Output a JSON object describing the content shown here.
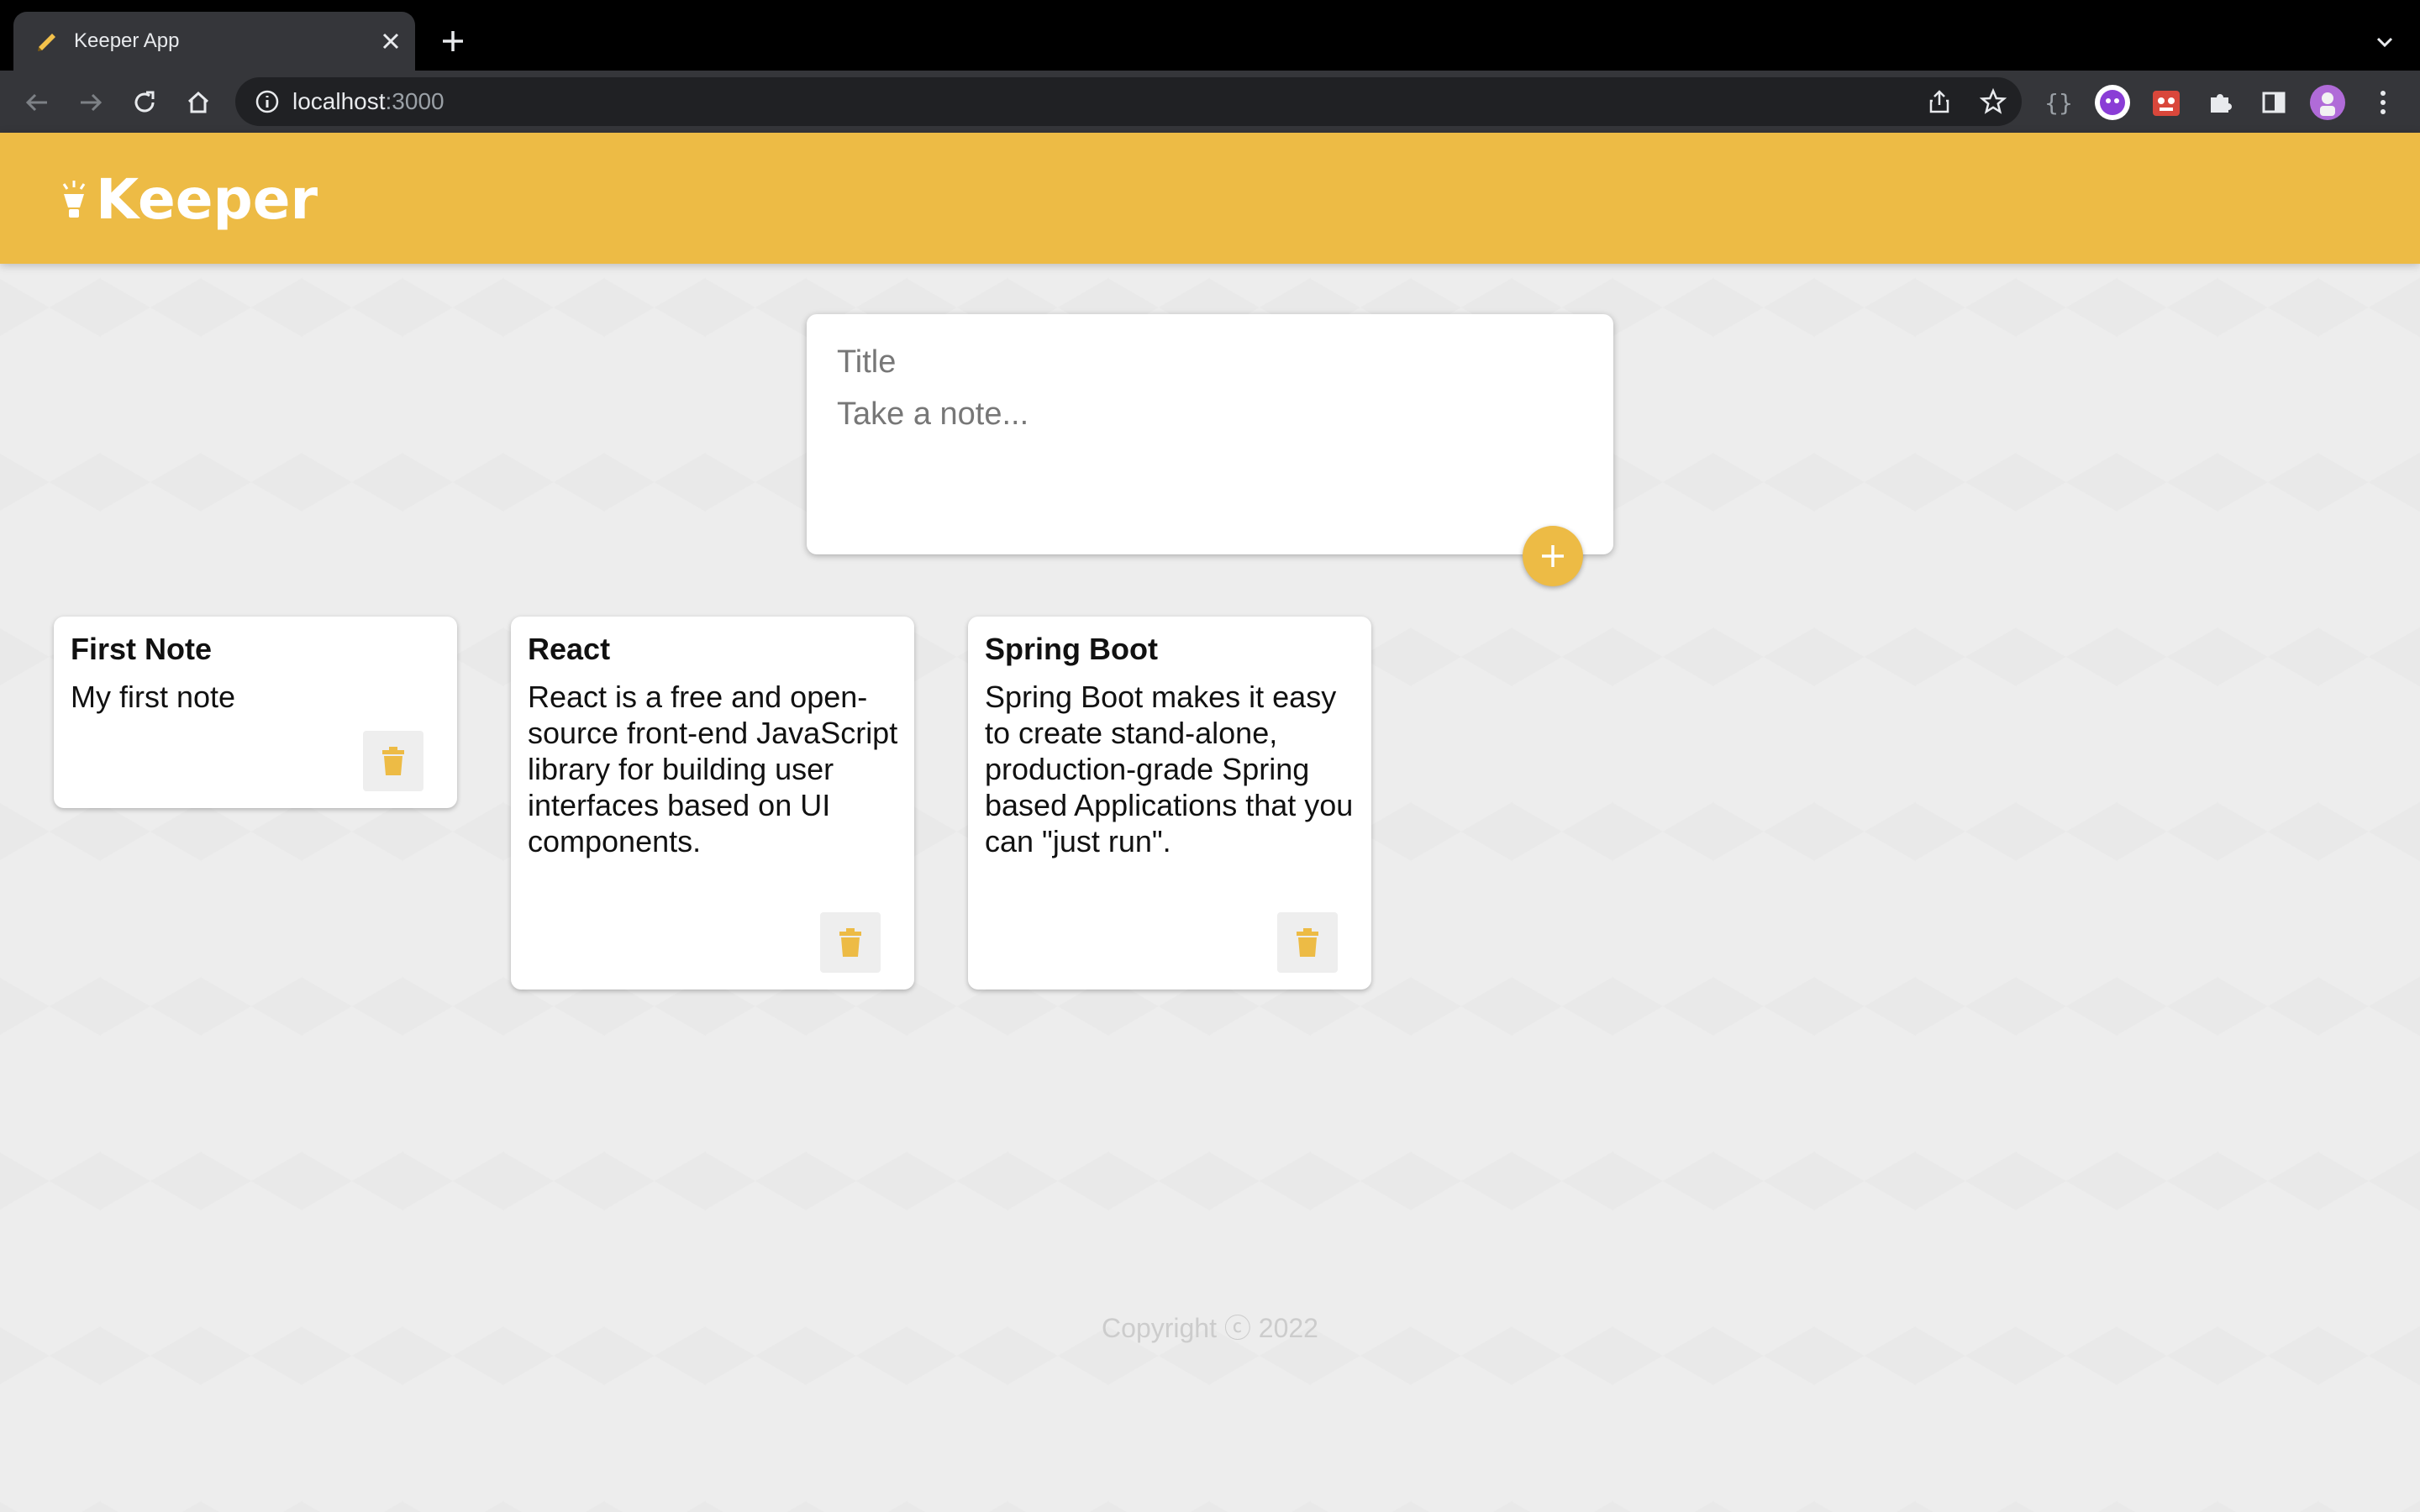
{
  "browser": {
    "tab_title": "Keeper App",
    "url_host": "localhost",
    "url_port": ":3000",
    "icons": [
      "tab-favicon-icon",
      "close-icon",
      "plus-icon",
      "chevron-down-icon",
      "back-icon",
      "forward-icon",
      "reload-icon",
      "home-icon",
      "info-icon",
      "share-icon",
      "star-icon",
      "braces-icon",
      "extension-icon",
      "puzzle-icon",
      "side-panel-icon",
      "avatar",
      "menu-dots-icon"
    ]
  },
  "header": {
    "logo_text": "Keeper",
    "icon": "lightbulb-icon",
    "color": "#edbb45"
  },
  "create_note": {
    "title_placeholder": "Title",
    "content_placeholder": "Take a note...",
    "add_icon": "plus-icon"
  },
  "notes": [
    {
      "title": "First Note",
      "content": "My first note"
    },
    {
      "title": "React",
      "content": "React is a free and open-source front-end JavaScript library for building user interfaces based on UI components."
    },
    {
      "title": "Spring Boot",
      "content": "Spring Boot makes it easy to create stand-alone, production-grade Spring based Applications that you can \"just run\"."
    }
  ],
  "footer": {
    "copyright": "Copyright ⓒ 2022"
  },
  "colors": {
    "accent": "#edbb45",
    "background": "#ededed",
    "chrome_dark": "#35363a"
  }
}
